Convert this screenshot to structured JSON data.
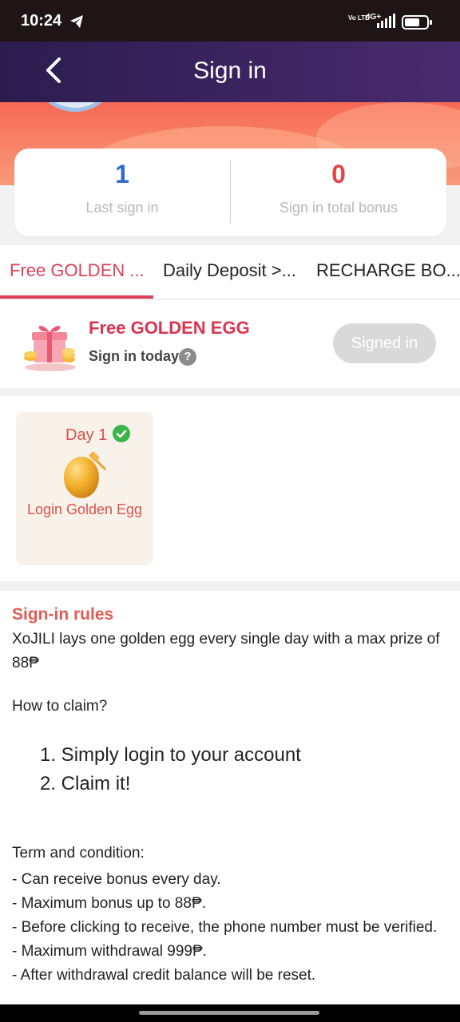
{
  "status_bar": {
    "time": "10:24",
    "network_top": "4G+",
    "network_volte": "Vo LTE",
    "icons": [
      "telegram-icon",
      "volte-icon",
      "signal-icon",
      "battery-icon"
    ]
  },
  "header": {
    "title": "Sign in",
    "back_icon": "chevron-left-icon"
  },
  "stats": {
    "last_sign_in_value": "1",
    "last_sign_in_label": "Last sign in",
    "total_bonus_value": "0",
    "total_bonus_label": "Sign in total bonus"
  },
  "tabs": [
    {
      "label": "Free GOLDEN ...",
      "active": true
    },
    {
      "label": "Daily Deposit >...",
      "active": false
    },
    {
      "label": "RECHARGE BO...",
      "active": false
    }
  ],
  "task": {
    "title": "Free GOLDEN EGG",
    "subtitle": "Sign in today",
    "help_icon": "help-icon",
    "button_label": "Signed in"
  },
  "days": [
    {
      "label": "Day 1",
      "reward": "Login Golden Egg",
      "checked": true
    }
  ],
  "rules": {
    "title": "Sign-in rules",
    "intro": "XoJILI lays one golden egg every single day with a max prize of 88₱",
    "claim_heading": "How to claim?",
    "steps": [
      "1. Simply login to your account",
      "2. Claim it!"
    ],
    "terms_heading": "Term and condition:",
    "terms": [
      "- Can receive bonus every day.",
      "- Maximum bonus up to 88₱.",
      "- Before clicking to receive, the phone number must be verified.",
      "- Maximum withdrawal 999₱.",
      "- After withdrawal credit balance will be reset."
    ]
  },
  "colors": {
    "header_start": "#2a1d4e",
    "header_end": "#4a2a6e",
    "accent_red": "#e0405a",
    "stat_blue": "#2f6bc4",
    "stat_red": "#e24749",
    "signed_button": "#d9d9d9"
  }
}
